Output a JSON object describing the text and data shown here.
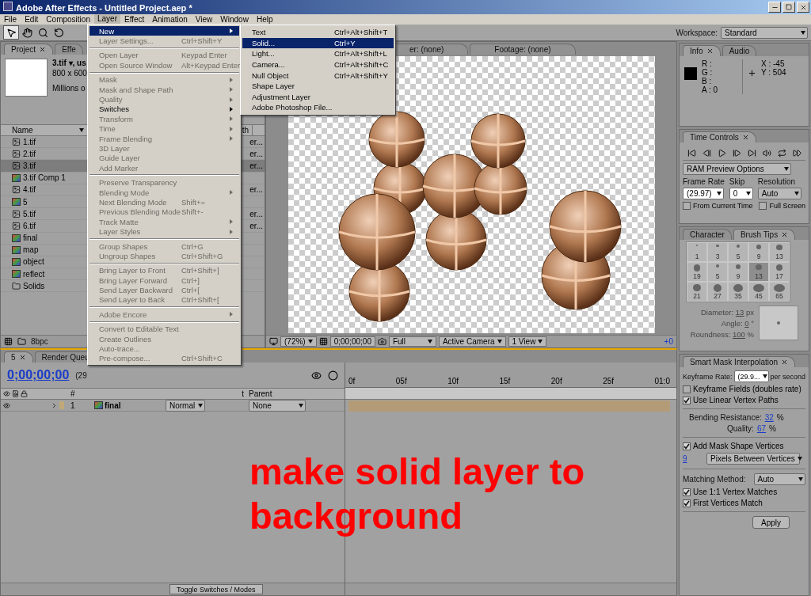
{
  "window": {
    "title": "Adobe After Effects - Untitled Project.aep *"
  },
  "menu_bar": [
    {
      "label": "File",
      "selected": false
    },
    {
      "label": "Edit",
      "selected": false
    },
    {
      "label": "Composition",
      "selected": false
    },
    {
      "label": "Layer",
      "selected": true
    },
    {
      "label": "Effect",
      "selected": false
    },
    {
      "label": "Animation",
      "selected": false
    },
    {
      "label": "View",
      "selected": false
    },
    {
      "label": "Window",
      "selected": false
    },
    {
      "label": "Help",
      "selected": false
    }
  ],
  "layer_menu": {
    "items": [
      {
        "kind": "item",
        "label": "New",
        "submenu": true,
        "disabled": false,
        "selected": true
      },
      {
        "kind": "item",
        "label": "Layer Settings...",
        "shortcut": "Ctrl+Shift+Y",
        "submenu": false,
        "disabled": true,
        "selected": false
      },
      {
        "kind": "separator"
      },
      {
        "kind": "item",
        "label": "Open Layer",
        "shortcut": "Keypad Enter",
        "submenu": false,
        "disabled": true,
        "selected": false
      },
      {
        "kind": "item",
        "label": "Open Source Window",
        "shortcut": "Alt+Keypad Enter",
        "submenu": false,
        "disabled": true,
        "selected": false
      },
      {
        "kind": "separator"
      },
      {
        "kind": "item",
        "label": "Mask",
        "submenu": true,
        "disabled": true,
        "selected": false
      },
      {
        "kind": "item",
        "label": "Mask and Shape Path",
        "submenu": true,
        "disabled": true,
        "selected": false
      },
      {
        "kind": "item",
        "label": "Quality",
        "submenu": true,
        "disabled": true,
        "selected": false
      },
      {
        "kind": "item",
        "label": "Switches",
        "submenu": true,
        "disabled": false,
        "selected": false
      },
      {
        "kind": "item",
        "label": "Transform",
        "submenu": true,
        "disabled": true,
        "selected": false
      },
      {
        "kind": "item",
        "label": "Time",
        "submenu": true,
        "disabled": true,
        "selected": false
      },
      {
        "kind": "item",
        "label": "Frame Blending",
        "submenu": true,
        "disabled": true,
        "selected": false
      },
      {
        "kind": "item",
        "label": "3D Layer",
        "submenu": false,
        "disabled": true,
        "selected": false
      },
      {
        "kind": "item",
        "label": "Guide Layer",
        "submenu": false,
        "disabled": true,
        "selected": false
      },
      {
        "kind": "item",
        "label": "Add Marker",
        "submenu": false,
        "disabled": true,
        "selected": false
      },
      {
        "kind": "separator"
      },
      {
        "kind": "item",
        "label": "Preserve Transparency",
        "submenu": false,
        "disabled": true,
        "selected": false
      },
      {
        "kind": "item",
        "label": "Blending Mode",
        "submenu": true,
        "disabled": true,
        "selected": false
      },
      {
        "kind": "item",
        "label": "Next Blending Mode",
        "shortcut": "Shift+=",
        "submenu": false,
        "disabled": true,
        "selected": false
      },
      {
        "kind": "item",
        "label": "Previous Blending Mode",
        "shortcut": "Shift+-",
        "submenu": false,
        "disabled": true,
        "selected": false
      },
      {
        "kind": "item",
        "label": "Track Matte",
        "submenu": true,
        "disabled": true,
        "selected": false
      },
      {
        "kind": "item",
        "label": "Layer Styles",
        "submenu": true,
        "disabled": true,
        "selected": false
      },
      {
        "kind": "separator"
      },
      {
        "kind": "item",
        "label": "Group Shapes",
        "shortcut": "Ctrl+G",
        "submenu": false,
        "disabled": true,
        "selected": false
      },
      {
        "kind": "item",
        "label": "Ungroup Shapes",
        "shortcut": "Ctrl+Shift+G",
        "submenu": false,
        "disabled": true,
        "selected": false
      },
      {
        "kind": "separator"
      },
      {
        "kind": "item",
        "label": "Bring Layer to Front",
        "shortcut": "Ctrl+Shift+]",
        "submenu": false,
        "disabled": true,
        "selected": false
      },
      {
        "kind": "item",
        "label": "Bring Layer Forward",
        "shortcut": "Ctrl+]",
        "submenu": false,
        "disabled": true,
        "selected": false
      },
      {
        "kind": "item",
        "label": "Send Layer Backward",
        "shortcut": "Ctrl+[",
        "submenu": false,
        "disabled": true,
        "selected": false
      },
      {
        "kind": "item",
        "label": "Send Layer to Back",
        "shortcut": "Ctrl+Shift+[",
        "submenu": false,
        "disabled": true,
        "selected": false
      },
      {
        "kind": "separator"
      },
      {
        "kind": "item",
        "label": "Adobe Encore",
        "submenu": true,
        "disabled": true,
        "selected": false
      },
      {
        "kind": "separator"
      },
      {
        "kind": "item",
        "label": "Convert to Editable Text",
        "submenu": false,
        "disabled": true,
        "selected": false
      },
      {
        "kind": "item",
        "label": "Create Outlines",
        "submenu": false,
        "disabled": true,
        "selected": false
      },
      {
        "kind": "item",
        "label": "Auto-trace...",
        "submenu": false,
        "disabled": true,
        "selected": false
      },
      {
        "kind": "item",
        "label": "Pre-compose...",
        "shortcut": "Ctrl+Shift+C",
        "submenu": false,
        "disabled": true,
        "selected": false
      }
    ]
  },
  "new_submenu": {
    "items": [
      {
        "label": "Text",
        "shortcut": "Ctrl+Alt+Shift+T",
        "selected": false
      },
      {
        "label": "Solid...",
        "shortcut": "Ctrl+Y",
        "selected": true
      },
      {
        "label": "Light...",
        "shortcut": "Ctrl+Alt+Shift+L",
        "selected": false
      },
      {
        "label": "Camera...",
        "shortcut": "Ctrl+Alt+Shift+C",
        "selected": false
      },
      {
        "label": "Null Object",
        "shortcut": "Ctrl+Alt+Shift+Y",
        "selected": false
      },
      {
        "label": "Shape Layer",
        "selected": false
      },
      {
        "label": "Adjustment Layer",
        "selected": false
      },
      {
        "label": "Adobe Photoshop File...",
        "selected": false
      }
    ]
  },
  "toolbar": {
    "workspace_label": "Workspace:",
    "workspace_value": "Standard"
  },
  "project_panel": {
    "tabs": [
      {
        "label": "Project",
        "selected": true,
        "closable": true
      },
      {
        "label": "Effe",
        "selected": false,
        "closable": false
      }
    ],
    "preview": {
      "name": "3.tif ▾, us",
      "size": "800 x 600",
      "color_depth": "Millions o"
    },
    "columns": [
      {
        "label": "Name"
      },
      {
        "label": "th"
      }
    ],
    "items": [
      {
        "name": "1.tif",
        "kind": "footage",
        "column_2": "er...",
        "selected": false
      },
      {
        "name": "2.tif",
        "kind": "footage",
        "column_2": "er...",
        "selected": false
      },
      {
        "name": "3.tif",
        "kind": "footage",
        "column_2": "er...",
        "selected": true
      },
      {
        "name": "3.tif Comp 1",
        "kind": "comp",
        "selected": false
      },
      {
        "name": "4.tif",
        "kind": "footage",
        "column_2": "er...",
        "selected": false
      },
      {
        "name": "5",
        "kind": "comp",
        "selected": false
      },
      {
        "name": "5.tif",
        "kind": "footage",
        "column_2": "er...",
        "selected": false
      },
      {
        "name": "6.tif",
        "kind": "footage",
        "column_2": "er...",
        "selected": false
      },
      {
        "name": "final",
        "kind": "comp",
        "selected": false
      },
      {
        "name": "map",
        "kind": "comp",
        "selected": false
      },
      {
        "name": "object",
        "kind": "comp",
        "selected": false
      },
      {
        "name": "reflect",
        "kind": "comp",
        "selected": false
      },
      {
        "name": "Solids",
        "kind": "folder",
        "selected": false
      }
    ],
    "footer": {
      "depth": "8bpc"
    }
  },
  "viewer": {
    "tabs": [
      {
        "label": "er: (none)"
      },
      {
        "label": "Footage: (none)"
      }
    ],
    "toolbar": {
      "zoom": "(72%)",
      "time": "0;00;00;00",
      "resolution": "Full",
      "camera": "Active Camera",
      "views": "1 View",
      "exposure": "+0"
    }
  },
  "timeline": {
    "tabs": [
      {
        "label": "5",
        "selected": true,
        "closable": true
      },
      {
        "label": "Render Queu",
        "selected": false,
        "closable": false
      }
    ],
    "time": "0;00;00;00",
    "fps": "(29",
    "columns": {
      "number": "#",
      "column_3": "t",
      "parent": "Parent"
    },
    "layers": [
      {
        "number": "1",
        "name": "final",
        "mode": "Normal",
        "parent": "None"
      }
    ],
    "ruler": [
      "0f",
      "05f",
      "10f",
      "15f",
      "20f",
      "25f",
      "01:0"
    ],
    "footer": {
      "toggle": "Toggle Switches / Modes"
    }
  },
  "info": {
    "tabs": [
      {
        "label": "Info",
        "selected": true,
        "closable": true
      },
      {
        "label": "Audio",
        "selected": false,
        "closable": false
      }
    ],
    "channels": [
      "R :",
      "G :",
      "B :",
      "A : 0"
    ],
    "x": "X : -45",
    "y": "Y : 504"
  },
  "time_controls": {
    "tabs": [
      {
        "label": "Time Controls",
        "selected": true,
        "closable": true
      }
    ],
    "preset": "RAM Preview Options",
    "frame_rate_label": "Frame Rate",
    "frame_rate": "(29.97)",
    "skip_label": "Skip",
    "skip": "0",
    "resolution_label": "Resolution",
    "resolution": "Auto",
    "options": [
      {
        "label": "From Current Time",
        "checked": false
      },
      {
        "label": "Full Screen",
        "checked": false
      }
    ]
  },
  "brush_tips": {
    "tabs": [
      {
        "label": "Character",
        "selected": false,
        "closable": false
      },
      {
        "label": "Brush Tips",
        "selected": true,
        "closable": true
      }
    ],
    "tips": [
      {
        "size": "1",
        "selected": false
      },
      {
        "size": "3",
        "selected": false
      },
      {
        "size": "5",
        "selected": false
      },
      {
        "size": "9",
        "selected": false
      },
      {
        "size": "13",
        "selected": false
      },
      {
        "size": "19",
        "selected": false
      },
      {
        "size": "5",
        "selected": false
      },
      {
        "size": "9",
        "selected": false
      },
      {
        "size": "13",
        "selected": true
      },
      {
        "size": "17",
        "selected": false
      },
      {
        "size": "21",
        "selected": false
      },
      {
        "size": "27",
        "selected": false
      },
      {
        "size": "35",
        "selected": false
      },
      {
        "size": "45",
        "selected": false
      },
      {
        "size": "65",
        "selected": false
      }
    ],
    "params": [
      {
        "label": "Diameter:",
        "value": "13",
        "unit": "px"
      },
      {
        "label": "Angle:",
        "value": "0",
        "unit": "°"
      },
      {
        "label": "Roundness:",
        "value": "100",
        "unit": "%"
      }
    ]
  },
  "smart_mask": {
    "tabs": [
      {
        "label": "Smart Mask Interpolation",
        "selected": true,
        "closable": true
      }
    ],
    "keyframe_rate_label": "Keyframe Rate:",
    "keyframe_rate": "(29.9...",
    "keyframe_rate_unit": "per second",
    "fields": {
      "label": "Keyframe Fields (doubles rate)",
      "checked": false
    },
    "linear": {
      "label": "Use Linear Vertex Paths",
      "checked": true
    },
    "bending_label": "Bending Resistance:",
    "bending": "32",
    "quality_label": "Quality:",
    "quality": "67",
    "percent": "%",
    "add_vertices": {
      "label": "Add Mask Shape Vertices",
      "checked": true
    },
    "pixels": "9",
    "pixels_mode": "Pixels Between Vertices",
    "matching_label": "Matching Method:",
    "matching": "Auto",
    "one_to_one": {
      "label": "Use 1:1 Vertex Matches",
      "checked": true
    },
    "first_match": {
      "label": "First Vertices Match",
      "checked": true
    },
    "apply": "Apply"
  },
  "annotation": "make solid layer to background"
}
